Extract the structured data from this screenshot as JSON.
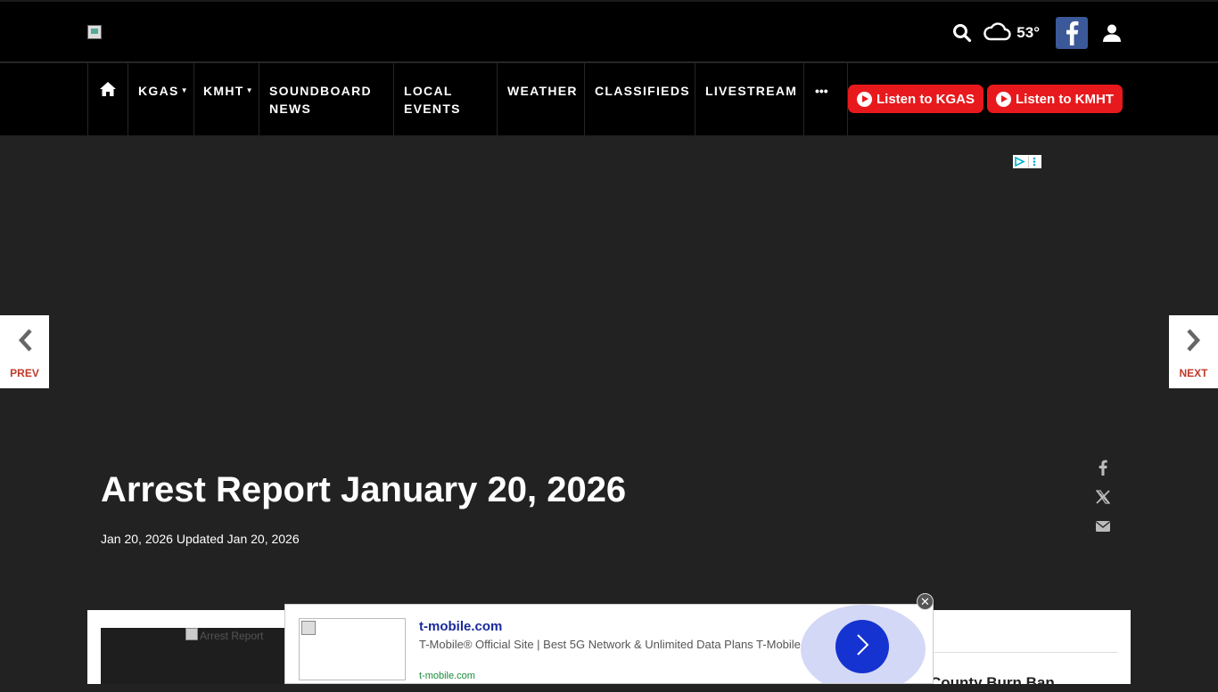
{
  "header": {
    "logo_alt": "",
    "weather": {
      "temp": "53°"
    }
  },
  "nav": {
    "items": [
      {
        "label": "KGAS",
        "has_dropdown": true
      },
      {
        "label": "KMHT",
        "has_dropdown": true
      },
      {
        "label": "SOUNDBOARD NEWS",
        "line1": "SOUNDBOARD",
        "line2": "NEWS"
      },
      {
        "label": "LOCAL EVENTS",
        "line1": "LOCAL",
        "line2": "EVENTS"
      },
      {
        "label": "WEATHER"
      },
      {
        "label": "CLASSIFIEDS"
      },
      {
        "label": "LIVESTREAM"
      }
    ],
    "more": "•••",
    "listen_buttons": [
      {
        "label": "Listen to KGAS"
      },
      {
        "label": "Listen to KMHT"
      }
    ]
  },
  "pager": {
    "prev": "PREV",
    "next": "NEXT"
  },
  "article": {
    "title": "Arrest Report January 20, 2026",
    "dates": "Jan 20, 2026 Updated Jan 20, 2026",
    "image_alt": "Arrest Report"
  },
  "sidebar": {
    "heading": "County Burn Ban"
  },
  "ad": {
    "title": "t-mobile.com",
    "description": "T-Mobile® Official Site | Best 5G Network & Unlimited Data Plans T-Mobile",
    "url": "t-mobile.com",
    "close": "✕"
  },
  "colors": {
    "accent_red": "#e8191c",
    "facebook_blue": "#3b5998",
    "page_bg": "#222222",
    "ad_button": "#1533d0"
  },
  "icons": [
    "search-icon",
    "cloud-icon",
    "facebook-icon",
    "user-icon",
    "home-icon",
    "play-icon",
    "chevron-left-icon",
    "chevron-right-icon",
    "x-icon",
    "mail-icon",
    "close-icon"
  ]
}
